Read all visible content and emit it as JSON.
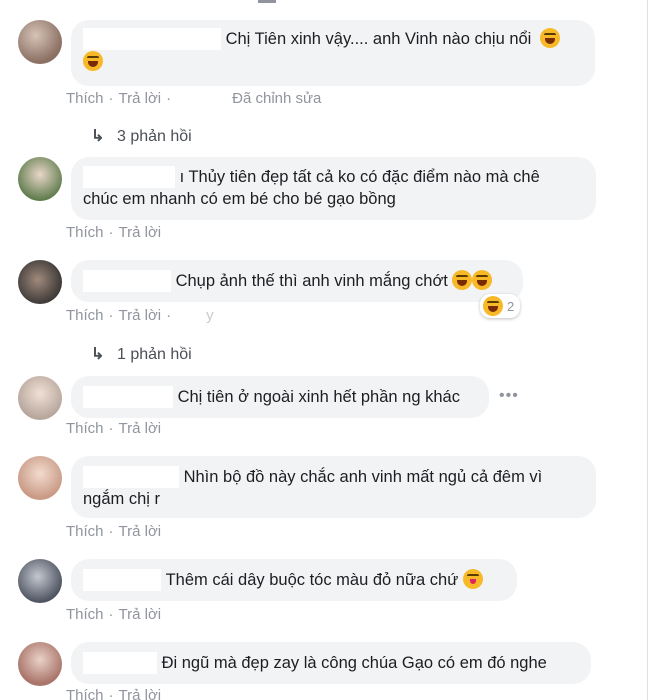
{
  "actions": {
    "like": "Thích",
    "reply": "Trả lời",
    "separator": "·"
  },
  "comments": [
    {
      "text": "Chị Tiên xinh vậy.... anh Vinh nào chịu nổi",
      "edited": "Đã chỉnh sửa",
      "replies": "3 phản hồi",
      "avatar_color": "#8a6f62"
    },
    {
      "text_line1": "ı Thủy tiên đẹp tất cả ko có đặc điểm nào mà chê",
      "text_line2": "chúc em nhanh có em bé cho bé gạo bồng",
      "avatar_color": "#5c7a4a"
    },
    {
      "text": "Chụp ảnh thế thì anh vinh mắng chớt",
      "reaction_count": "2",
      "faint_mark": "y",
      "replies": "1 phản hồi",
      "avatar_color": "#3e3a38"
    },
    {
      "text": "Chị tiên ở ngoài xinh hết phần ng khác",
      "more": "•••",
      "avatar_color": "#b8a79c"
    },
    {
      "text_line1": "Nhìn bộ đồ này chắc anh vinh mất ngủ cả đêm vì",
      "text_line2": "ngắm chị r",
      "avatar_color": "#c99a86"
    },
    {
      "text": "Thêm cái dây buộc tóc màu đỏ nữa chứ",
      "avatar_color": "#4f5562"
    },
    {
      "text": "Đi ngũ mà đẹp zay là công chúa Gạo có em đó nghe",
      "avatar_color": "#a9746a"
    }
  ],
  "colors": {
    "bubble": "#f2f3f5",
    "meta": "#90949c",
    "link": "#4b4f56"
  }
}
